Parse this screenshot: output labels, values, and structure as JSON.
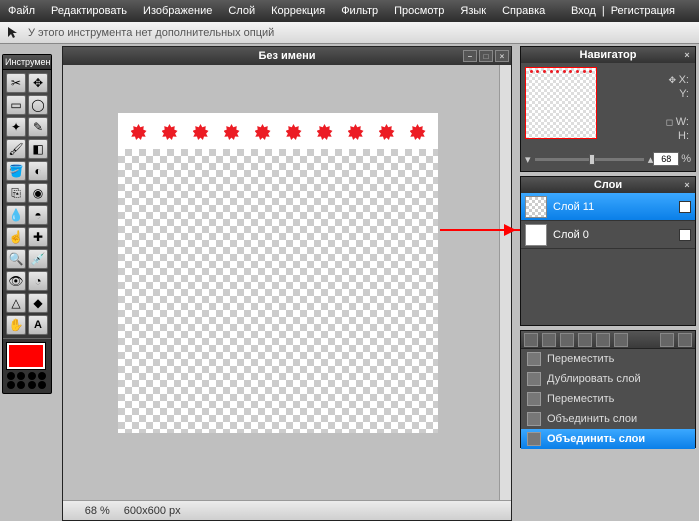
{
  "menu": {
    "file": "Файл",
    "edit": "Редактировать",
    "image": "Изображение",
    "layer": "Слой",
    "adjust": "Коррекция",
    "filter": "Фильтр",
    "view": "Просмотр",
    "lang": "Язык",
    "help": "Справка",
    "login": "Вход",
    "register": "Регистрация"
  },
  "options": {
    "text": "У этого инструмента нет дополнительных опций"
  },
  "toolbox": {
    "title": "Инструмен"
  },
  "doc": {
    "title": "Без имени",
    "zoom": "68",
    "pct": "%",
    "dims": "600x600 px"
  },
  "nav": {
    "title": "Навигатор",
    "x": "X:",
    "y": "Y:",
    "w": "W:",
    "h": "H:",
    "zoom": "68",
    "pct": "%"
  },
  "layers": {
    "title": "Слои",
    "items": [
      {
        "name": "Слой 11",
        "sel": true
      },
      {
        "name": "Слой 0",
        "sel": false
      }
    ]
  },
  "ctx": {
    "items": [
      {
        "label": "Переместить",
        "sel": false
      },
      {
        "label": "Дублировать слой",
        "sel": false
      },
      {
        "label": "Переместить",
        "sel": false
      },
      {
        "label": "Объединить слои",
        "sel": false
      },
      {
        "label": "Объединить слои",
        "sel": true
      }
    ]
  },
  "colors": {
    "primary": "#ff0000",
    "shape": "#ec1c24"
  }
}
